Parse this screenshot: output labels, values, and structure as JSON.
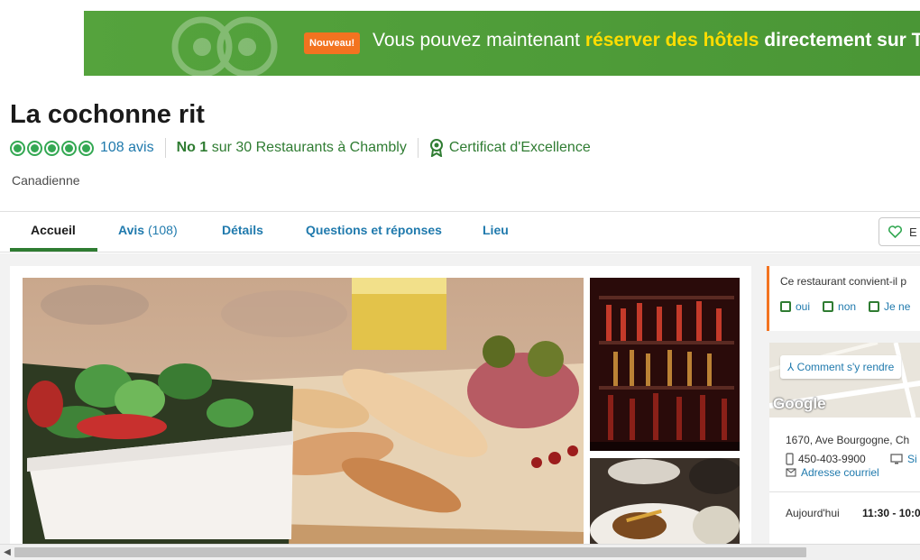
{
  "banner": {
    "badge": "Nouveau!",
    "text_before": "Vous pouvez maintenant ",
    "text_highlight": "réserver des hôtels",
    "text_after": " directement sur Trip"
  },
  "restaurant": {
    "name": "La cochonne rit",
    "rating_bubbles": 5,
    "reviews_link": "108 avis",
    "rank_no": "No 1",
    "rank_rest": " sur 30 Restaurants à Chambly",
    "certificate": "Certificat d'Excellence",
    "cuisine": "Canadienne"
  },
  "tabs": [
    {
      "label": "Accueil",
      "count": "",
      "active": true
    },
    {
      "label": "Avis",
      "count": " (108)",
      "active": false
    },
    {
      "label": "Détails",
      "count": "",
      "active": false
    },
    {
      "label": "Questions et réponses",
      "count": "",
      "active": false
    },
    {
      "label": "Lieu",
      "count": "",
      "active": false
    }
  ],
  "save_button": {
    "label": "E"
  },
  "poll": {
    "question": "Ce restaurant convient-il p",
    "options": [
      "oui",
      "non",
      "Je ne"
    ]
  },
  "map_card": {
    "directions": "Comment s'y rendre",
    "map_logo": "Google",
    "address": "1670, Ave Bourgogne, Ch",
    "phone": "450-403-9900",
    "website": "Si",
    "email": "Adresse courriel",
    "hours_label": "Aujourd'hui",
    "hours_value": "11:30 - 10:0"
  },
  "colors": {
    "brand_green": "#2f7c32",
    "bubble_green": "#34a853",
    "link_blue": "#207aad",
    "accent_orange": "#f37320",
    "banner_highlight": "#ffdd00"
  }
}
